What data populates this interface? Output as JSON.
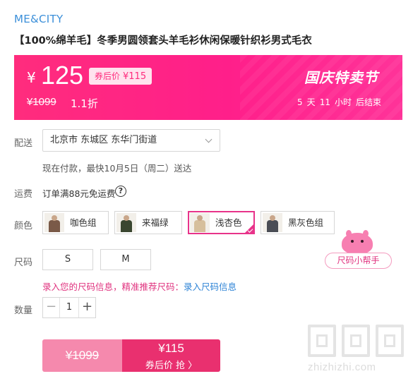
{
  "brand": "ME&CITY",
  "product_title": "【100%绵羊毛】冬季男圆领套头羊毛衫休闲保暖针织衫男式毛衣",
  "promo": {
    "currency": "¥",
    "price": "125",
    "coupon_label": "券后价",
    "coupon_price": "¥115",
    "original_price": "¥1099",
    "discount": "1.1折",
    "event_name": "国庆特卖节",
    "countdown_days": "5",
    "days_unit": "天",
    "countdown_hours": "11",
    "hours_unit": "小时",
    "ends_text": "后结束"
  },
  "delivery": {
    "label": "配送",
    "address": "北京市 东城区 东华门街道",
    "note": "现在付款，最快10月5日（周二）送达"
  },
  "freight": {
    "label": "运费",
    "text": "订单满88元免运费",
    "help_icon": "?"
  },
  "color": {
    "label": "颜色",
    "options": [
      {
        "name": "咖色组",
        "shirt": "#7a5a48",
        "selected": false
      },
      {
        "name": "来福绿",
        "shirt": "#3a4630",
        "selected": false
      },
      {
        "name": "浅杏色",
        "shirt": "#d6bf9c",
        "selected": true
      },
      {
        "name": "黑灰色组",
        "shirt": "#4a4d55",
        "selected": false
      }
    ]
  },
  "size": {
    "label": "尺码",
    "options": [
      "S",
      "M"
    ],
    "note_prefix": "录入您的尺码信息，精准推荐尺码：",
    "note_link": "录入尺码信息",
    "helper": "尺码小帮手"
  },
  "quantity": {
    "label": "数量",
    "minus": "−",
    "value": "1",
    "plus": "+"
  },
  "buy": {
    "original_price": "¥1099",
    "price": "¥115",
    "action": "券后价 抢 〉"
  },
  "watermark": "zhizhizhi.com",
  "colors": {
    "accent": "#e9306f",
    "banner": "#ff2c7d",
    "brand": "#3b8fd9",
    "link": "#2f84d6"
  }
}
